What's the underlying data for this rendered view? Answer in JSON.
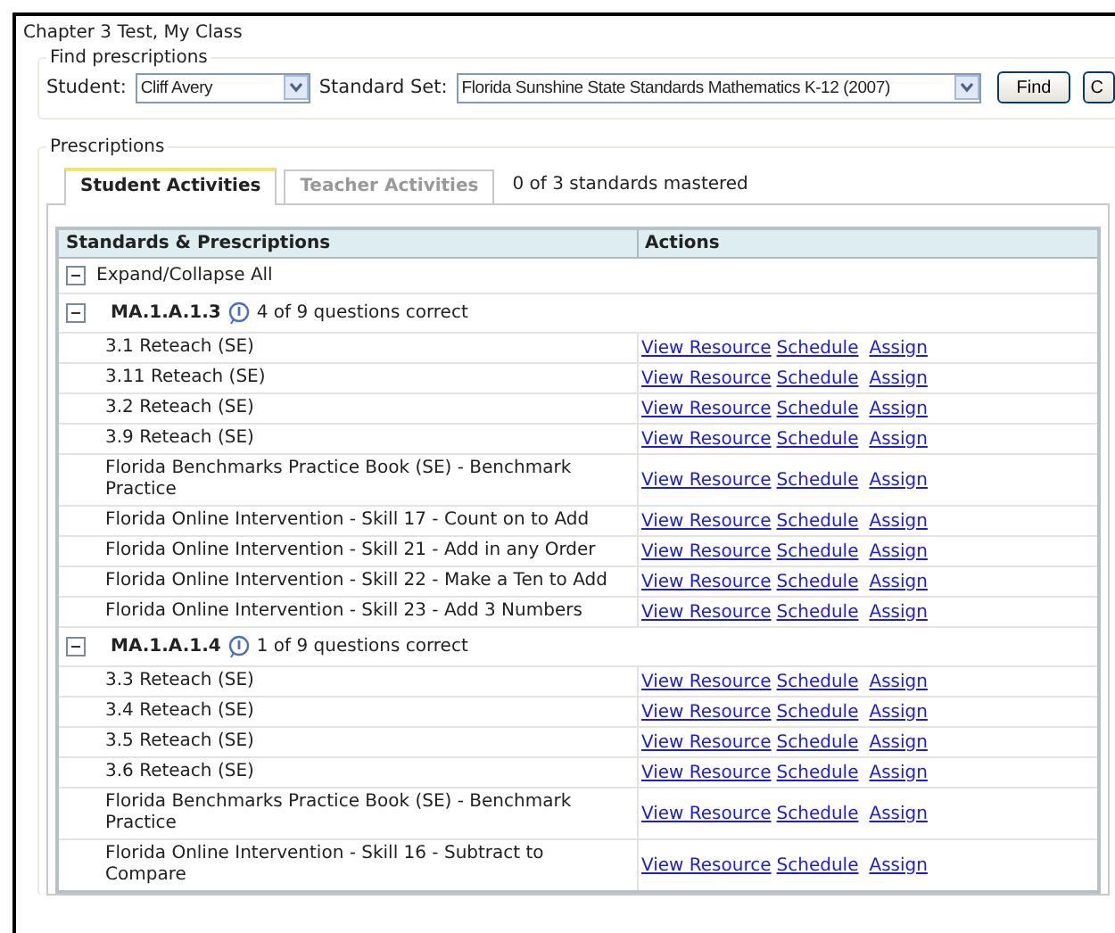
{
  "window": {
    "title": "Chapter 3 Test, My Class"
  },
  "find": {
    "legend": "Find prescriptions",
    "student_label": "Student:",
    "student": "Cliff Avery",
    "set_label": "Standard Set:",
    "set": "Florida Sunshine State Standards Mathematics K-12 (2007)",
    "buttons": [
      "Find",
      "C"
    ]
  },
  "prescriptions": {
    "legend": "Prescriptions",
    "tabs": [
      {
        "label": "Student Activities",
        "selected": true
      },
      {
        "label": "Teacher Activities",
        "selected": false
      }
    ],
    "mastered": "0 of 3 standards mastered",
    "table": {
      "columns": [
        "Standards & Prescriptions",
        "Actions"
      ],
      "expand_all": {
        "label": "Expand/Collapse All",
        "expanded": true
      },
      "groups": [
        {
          "code": "MA.1.A.1.3",
          "result": "4 of 9 questions correct",
          "expanded": true,
          "items": [
            {
              "name": "3.1 Reteach (SE)",
              "actions": [
                "View Resource",
                "Schedule",
                "Assign"
              ]
            },
            {
              "name": "3.11 Reteach (SE)",
              "actions": [
                "View Resource",
                "Schedule",
                "Assign"
              ]
            },
            {
              "name": "3.2 Reteach (SE)",
              "actions": [
                "View Resource",
                "Schedule",
                "Assign"
              ]
            },
            {
              "name": "3.9 Reteach (SE)",
              "actions": [
                "View Resource",
                "Schedule",
                "Assign"
              ]
            },
            {
              "name": "Florida Benchmarks Practice Book (SE) - Benchmark Practice",
              "actions": [
                "View Resource",
                "Schedule",
                "Assign"
              ]
            },
            {
              "name": "Florida Online Intervention - Skill 17 - Count on to Add",
              "actions": [
                "View Resource",
                "Schedule",
                "Assign"
              ]
            },
            {
              "name": "Florida Online Intervention - Skill 21 - Add in any Order",
              "actions": [
                "View Resource",
                "Schedule",
                "Assign"
              ]
            },
            {
              "name": "Florida Online Intervention - Skill 22 - Make a Ten to Add",
              "actions": [
                "View Resource",
                "Schedule",
                "Assign"
              ]
            },
            {
              "name": "Florida Online Intervention - Skill 23 - Add 3 Numbers",
              "actions": [
                "View Resource",
                "Schedule",
                "Assign"
              ]
            }
          ]
        },
        {
          "code": "MA.1.A.1.4",
          "result": "1 of 9 questions correct",
          "expanded": true,
          "items": [
            {
              "name": "3.3 Reteach (SE)",
              "actions": [
                "View Resource",
                "Schedule",
                "Assign"
              ]
            },
            {
              "name": "3.4 Reteach (SE)",
              "actions": [
                "View Resource",
                "Schedule",
                "Assign"
              ]
            },
            {
              "name": "3.5 Reteach (SE)",
              "actions": [
                "View Resource",
                "Schedule",
                "Assign"
              ]
            },
            {
              "name": "3.6 Reteach (SE)",
              "actions": [
                "View Resource",
                "Schedule",
                "Assign"
              ]
            },
            {
              "name": "Florida Benchmarks Practice Book (SE) - Benchmark Practice",
              "actions": [
                "View Resource",
                "Schedule",
                "Assign"
              ]
            },
            {
              "name": "Florida Online Intervention - Skill 16 - Subtract to Compare",
              "actions": [
                "View Resource",
                "Schedule",
                "Assign"
              ]
            }
          ]
        }
      ]
    }
  }
}
